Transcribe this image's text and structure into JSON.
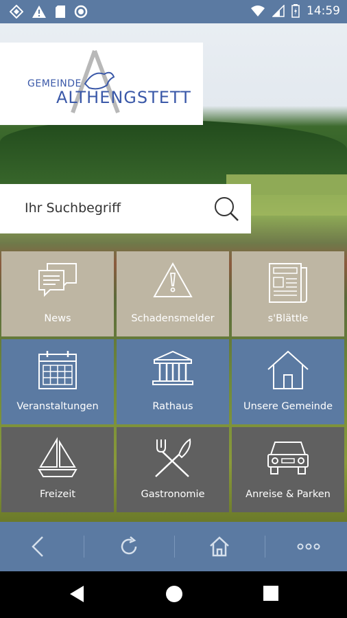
{
  "status_bar": {
    "time": "14:59"
  },
  "header": {
    "logo_small": "GEMEINDE",
    "logo_big": "ALTHENGSTETT"
  },
  "search": {
    "placeholder": "Ihr Suchbegriff"
  },
  "tiles": [
    {
      "label": "News",
      "icon": "speech-bubbles-icon"
    },
    {
      "label": "Schadensmelder",
      "icon": "warning-icon"
    },
    {
      "label": "s'Blättle",
      "icon": "newspaper-icon"
    },
    {
      "label": "Veranstaltungen",
      "icon": "calendar-icon"
    },
    {
      "label": "Rathaus",
      "icon": "townhall-icon"
    },
    {
      "label": "Unsere Gemeinde",
      "icon": "house-icon"
    },
    {
      "label": "Freizeit",
      "icon": "sailboat-icon"
    },
    {
      "label": "Gastronomie",
      "icon": "cutlery-icon"
    },
    {
      "label": "Anreise & Parken",
      "icon": "car-icon"
    }
  ],
  "colors": {
    "brand_blue": "#5b7aa2",
    "beige": "#beb6a3",
    "gray": "#606060",
    "logo_blue": "#3a58a8"
  }
}
